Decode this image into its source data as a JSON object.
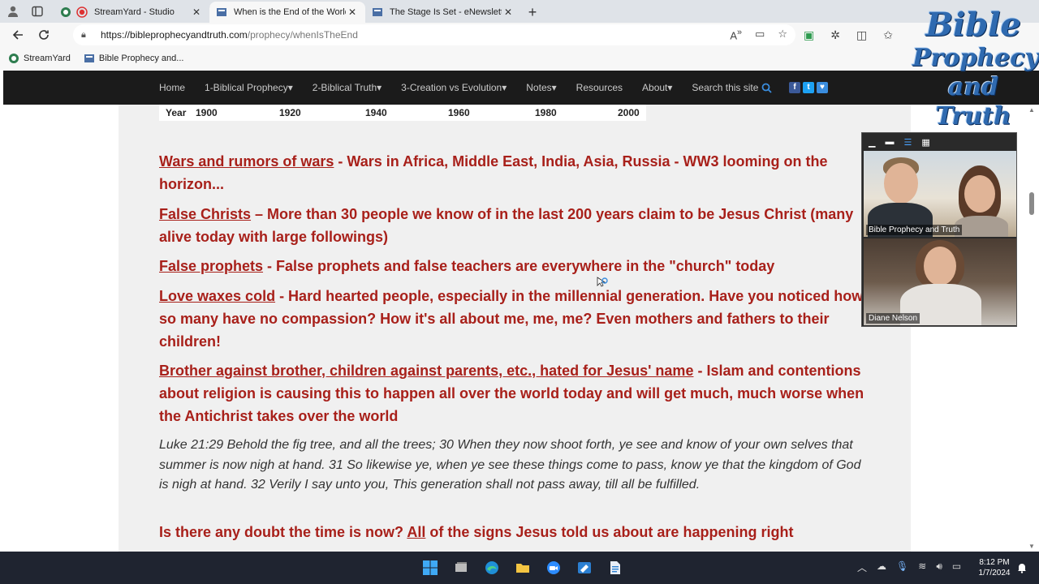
{
  "browser": {
    "tabs": [
      {
        "title": "StreamYard - Studio",
        "active": false
      },
      {
        "title": "When is the End of the World - B",
        "active": true
      },
      {
        "title": "The Stage Is Set - eNewsletter",
        "active": false
      }
    ],
    "url_host": "https://bibleprophecyandtruth.com",
    "url_path": "/prophecy/whenIsTheEnd",
    "bookmarks": [
      "StreamYard",
      "Bible Prophecy and..."
    ]
  },
  "site_nav": {
    "items": [
      "Home",
      "1-Biblical Prophecy",
      "2-Biblical Truth",
      "3-Creation vs Evolution",
      "Notes",
      "Resources",
      "About"
    ],
    "search_label": "Search this site",
    "social": [
      "f",
      "t",
      "♥"
    ]
  },
  "logo": {
    "line1": "Bible",
    "line2": "Prophecy",
    "line3": "and Truth"
  },
  "chart_strip": {
    "label": "Year",
    "years": [
      "1900",
      "1920",
      "1940",
      "1960",
      "1980",
      "2000"
    ]
  },
  "signs": [
    {
      "head": "Wars and rumors of wars",
      "text": " - Wars in Africa, Middle East, India, Asia, Russia - WW3 looming on the horizon..."
    },
    {
      "head": "False Christs",
      "text": " – More than 30 people we know of in the last 200 years claim to be Jesus Christ (many alive today with large followings)"
    },
    {
      "head": "False prophets",
      "text": " - False prophets and false teachers are everywhere in the \"church\" today"
    },
    {
      "head": "Love waxes cold",
      "text": " - Hard hearted people, especially in the millennial generation. Have you noticed how so many have no compassion? How it's all about me, me, me? Even mothers and fathers to their children!"
    },
    {
      "head": "Brother against brother, children against parents, etc., hated for Jesus' name",
      "text": " - Islam and contentions about religion is causing this to happen all over the world today and will get much, much worse when the Antichrist takes over the world"
    }
  ],
  "scripture": "Luke 21:29 Behold the fig tree, and all the trees; 30 When they now shoot forth, ye see and know of your own selves that summer is now nigh at hand. 31 So likewise ye, when ye see these things come to pass, know ye that the kingdom of God is nigh at hand. 32 Verily I say unto you, This generation shall not pass away, till all be fulfilled.",
  "closing": {
    "before": "Is there any doubt the time is now? ",
    "underlined": "All",
    "after": " of the signs Jesus told us about are happening right"
  },
  "video": {
    "cam1_label": "Bible Prophecy and Truth",
    "cam2_label": "Diane Nelson"
  },
  "taskbar": {
    "time": "8:12 PM",
    "date": "1/7/2024"
  },
  "colors": {
    "sign_red": "#a8201a",
    "nav_bg": "#1b1b1b"
  }
}
